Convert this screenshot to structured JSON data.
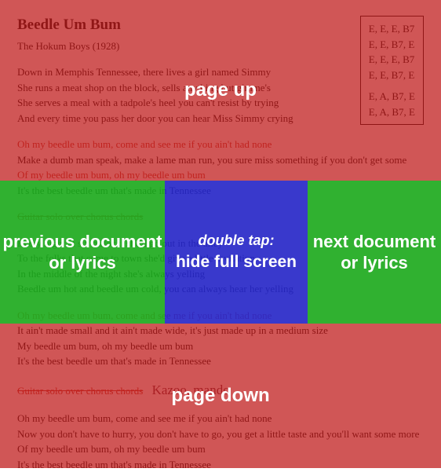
{
  "song": {
    "title": "Beedle Um Bum",
    "artist_year": "The Hokum Boys (1928)"
  },
  "chords": {
    "r1": "E, E, E, B7",
    "r2": "E, E, B7, E",
    "r3": "E, E, E, B7",
    "r4": "E, E, B7, E",
    "r5": "E, A, B7, E",
    "r6": "E, A, B7, E"
  },
  "v1": {
    "l1": "Down in Memphis Tennessee, there lives a girl named Simmy",
    "l2": "She runs a meat shop on the block, sells anything but gimme's",
    "l3": "She serves a meal with a tadpole's heel you can't resist by trying",
    "l4": "And every time you pass her door you can hear Miss Simmy crying"
  },
  "c1": {
    "l1": "Oh my beedle um bum, come and see me if you ain't had none",
    "l2": "Make a dumb man speak, make a lame man run, you sure miss something if you don't get some",
    "l3": "Of my beedle um bum, oh my beedle um bum",
    "l4": "It's the best beedle um that's made in Tennessee"
  },
  "solo1": "Guitar solo over chorus chords",
  "v2": {
    "l1": "Every night at six o'clock, she'd go out in the alley",
    "l2": "To the folks that come to town she'd give a little invitation",
    "l3": "In the middle of the night she's always yelling",
    "l4": "Beedle um hot and beedle um cold, you can always hear her yelling"
  },
  "c2": {
    "l1": "Oh my beedle um bum, come and see me if you ain't had none",
    "l2": "It ain't made small and it ain't made wide, it's just made up in a medium size",
    "l3": "My beedle um bum, oh my beedle um bum",
    "l4": "It's the best beedle um that's made in Tennessee"
  },
  "solo2": "Guitar solo over chorus chords",
  "hand": "Kazoo, mando",
  "c3": {
    "l1": "Oh my beedle um bum, come and see me if you ain't had none",
    "l2": "Now you don't have to hurry, you don't have to go, you get a little taste and you'll want some more",
    "l3": "Of my beedle um bum, oh my beedle um bum",
    "l4": "It's the best beedle um that's made in Tennessee"
  },
  "overlay": {
    "up": "page up",
    "down": "page down",
    "prev": "previous document or lyrics",
    "next": "next document or lyrics",
    "mid_label": "double tap:",
    "mid_action": "hide full screen"
  }
}
